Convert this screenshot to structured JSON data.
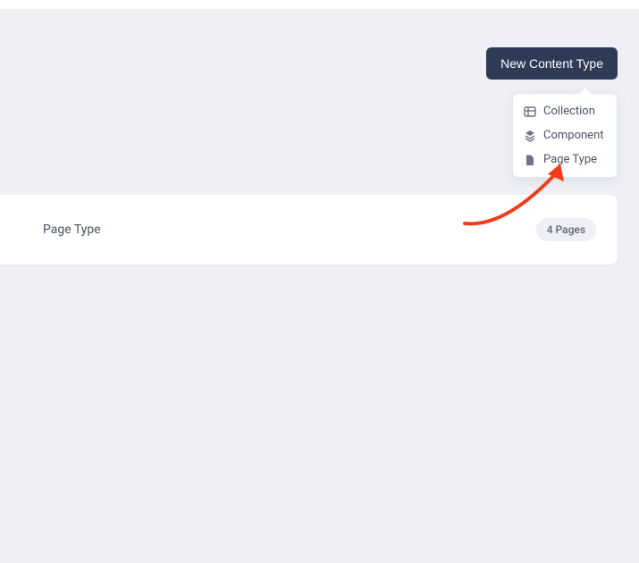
{
  "toolbar": {
    "new_content_type_label": "New Content Type"
  },
  "dropdown": {
    "items": [
      {
        "label": "Collection",
        "icon": "table-icon"
      },
      {
        "label": "Component",
        "icon": "layers-icon"
      },
      {
        "label": "Page Type",
        "icon": "file-icon"
      }
    ]
  },
  "card": {
    "title": "Page Type",
    "badge": "4 Pages"
  },
  "annotation": {
    "arrow_color": "#f03e1b"
  }
}
